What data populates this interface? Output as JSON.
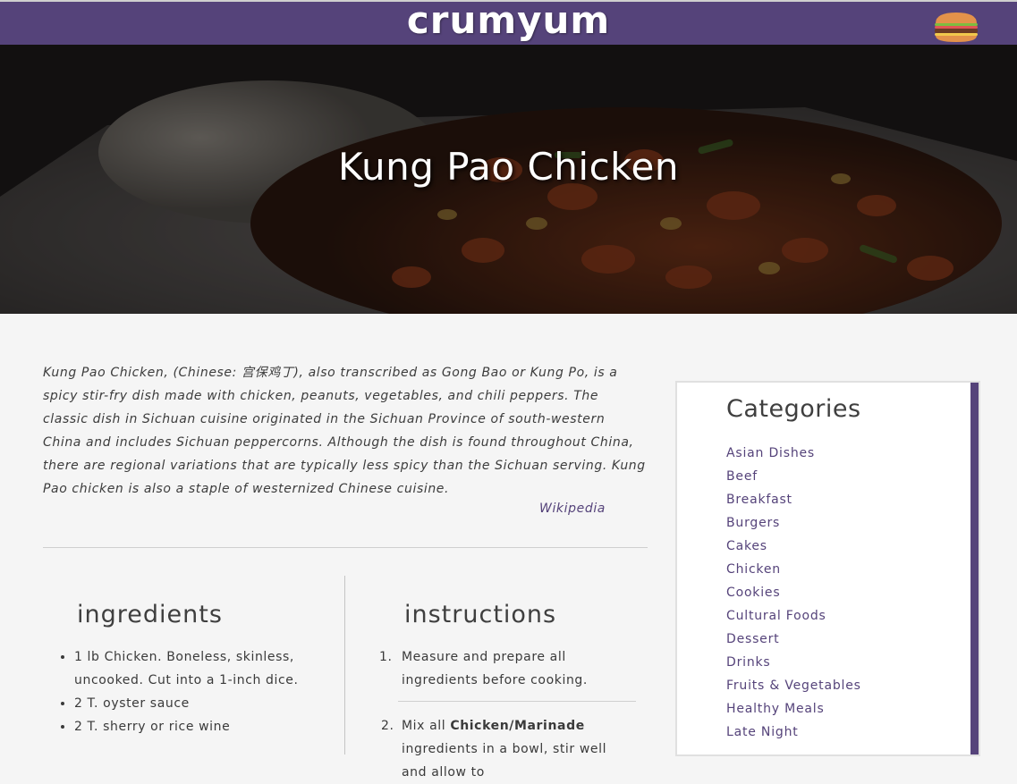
{
  "header": {
    "logo": "crumyum",
    "menu_icon": "hamburger-icon"
  },
  "hero": {
    "title": "Kung Pao Chicken"
  },
  "description": {
    "text": "Kung Pao Chicken, (Chinese: 宫保鸡丁), also transcribed as Gong Bao or Kung Po, is a spicy stir-fry dish made with chicken, peanuts, vegetables, and chili peppers. The classic dish in Sichuan cuisine originated in the Sichuan Province of south-western China and includes Sichuan peppercorns. Although the dish is found throughout China, there are regional variations that are typically less spicy than the Sichuan serving. Kung Pao chicken is also a staple of westernized Chinese cuisine.",
    "source": "Wikipedia"
  },
  "ingredients": {
    "title": "ingredients",
    "items": [
      "1 lb Chicken. Boneless, skinless, uncooked. Cut into a 1-inch dice.",
      "2 T. oyster sauce",
      "2 T. sherry or rice wine"
    ]
  },
  "instructions": {
    "title": "instructions",
    "steps": [
      {
        "num": "1.",
        "text": "Measure and prepare all ingredients before cooking."
      },
      {
        "num": "2.",
        "pre": "Mix all ",
        "bold": "Chicken/Marinade",
        "post": " ingredients in a bowl, stir well and allow to"
      }
    ]
  },
  "sidebar": {
    "title": "Categories",
    "categories": [
      "Asian Dishes",
      "Beef",
      "Breakfast",
      "Burgers",
      "Cakes",
      "Chicken",
      "Cookies",
      "Cultural Foods",
      "Dessert",
      "Drinks",
      "Fruits & Vegetables",
      "Healthy Meals",
      "Late Night"
    ]
  },
  "colors": {
    "brand": "#55437a",
    "background": "#f5f5f5"
  }
}
